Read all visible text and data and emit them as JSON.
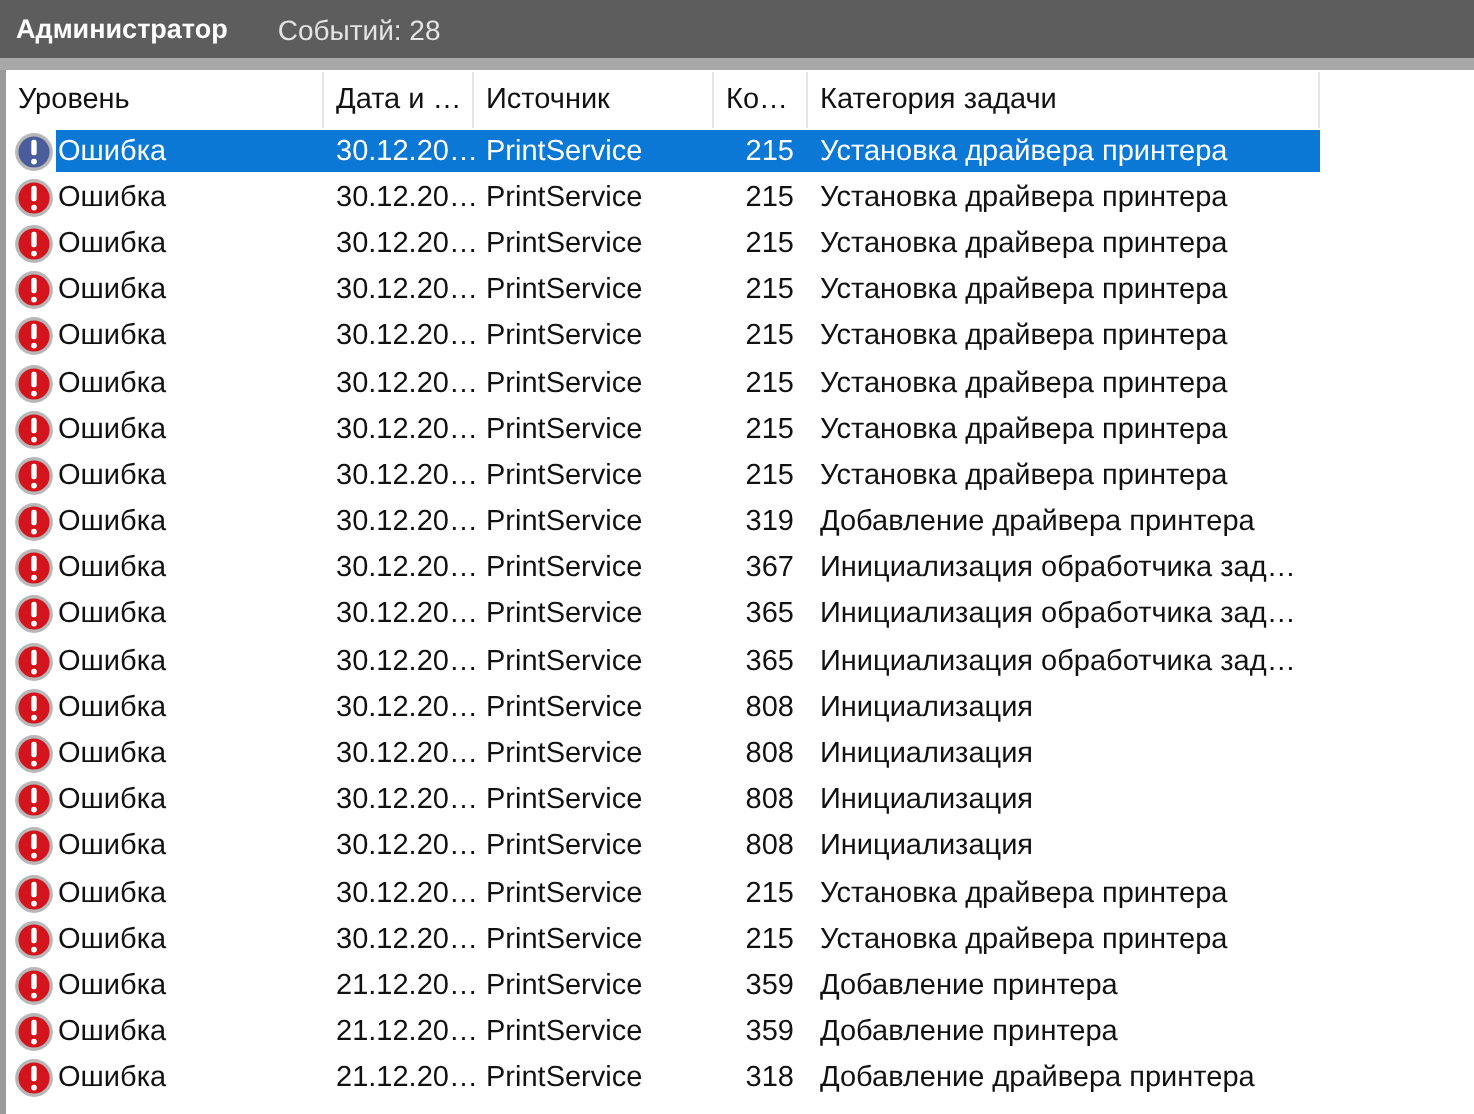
{
  "header": {
    "title": "Администратор",
    "count": "Событий: 28"
  },
  "table": {
    "columns": [
      "Уровень",
      "Дата и …",
      "Источник",
      "Ко…",
      "Категория задачи"
    ],
    "rows": [
      {
        "selected": true,
        "level": "Ошибка",
        "date": "30.12.20…",
        "source": "PrintService",
        "code": "215",
        "category": "Установка драйвера принтера"
      },
      {
        "selected": false,
        "level": "Ошибка",
        "date": "30.12.20…",
        "source": "PrintService",
        "code": "215",
        "category": "Установка драйвера принтера"
      },
      {
        "selected": false,
        "level": "Ошибка",
        "date": "30.12.20…",
        "source": "PrintService",
        "code": "215",
        "category": "Установка драйвера принтера"
      },
      {
        "selected": false,
        "level": "Ошибка",
        "date": "30.12.20…",
        "source": "PrintService",
        "code": "215",
        "category": "Установка драйвера принтера"
      },
      {
        "selected": false,
        "level": "Ошибка",
        "date": "30.12.20…",
        "source": "PrintService",
        "code": "215",
        "category": "Установка драйвера принтера"
      },
      {
        "selected": false,
        "level": "Ошибка",
        "date": "30.12.20…",
        "source": "PrintService",
        "code": "215",
        "category": "Установка драйвера принтера"
      },
      {
        "selected": false,
        "level": "Ошибка",
        "date": "30.12.20…",
        "source": "PrintService",
        "code": "215",
        "category": "Установка драйвера принтера"
      },
      {
        "selected": false,
        "level": "Ошибка",
        "date": "30.12.20…",
        "source": "PrintService",
        "code": "215",
        "category": "Установка драйвера принтера"
      },
      {
        "selected": false,
        "level": "Ошибка",
        "date": "30.12.20…",
        "source": "PrintService",
        "code": "319",
        "category": "Добавление драйвера принтера"
      },
      {
        "selected": false,
        "level": "Ошибка",
        "date": "30.12.20…",
        "source": "PrintService",
        "code": "367",
        "category": "Инициализация обработчика зад…"
      },
      {
        "selected": false,
        "level": "Ошибка",
        "date": "30.12.20…",
        "source": "PrintService",
        "code": "365",
        "category": "Инициализация обработчика зад…"
      },
      {
        "selected": false,
        "level": "Ошибка",
        "date": "30.12.20…",
        "source": "PrintService",
        "code": "365",
        "category": "Инициализация обработчика зад…"
      },
      {
        "selected": false,
        "level": "Ошибка",
        "date": "30.12.20…",
        "source": "PrintService",
        "code": "808",
        "category": "Инициализация"
      },
      {
        "selected": false,
        "level": "Ошибка",
        "date": "30.12.20…",
        "source": "PrintService",
        "code": "808",
        "category": "Инициализация"
      },
      {
        "selected": false,
        "level": "Ошибка",
        "date": "30.12.20…",
        "source": "PrintService",
        "code": "808",
        "category": "Инициализация"
      },
      {
        "selected": false,
        "level": "Ошибка",
        "date": "30.12.20…",
        "source": "PrintService",
        "code": "808",
        "category": "Инициализация"
      },
      {
        "selected": false,
        "level": "Ошибка",
        "date": "30.12.20…",
        "source": "PrintService",
        "code": "215",
        "category": "Установка драйвера принтера"
      },
      {
        "selected": false,
        "level": "Ошибка",
        "date": "30.12.20…",
        "source": "PrintService",
        "code": "215",
        "category": "Установка драйвера принтера"
      },
      {
        "selected": false,
        "level": "Ошибка",
        "date": "21.12.20…",
        "source": "PrintService",
        "code": "359",
        "category": "Добавление принтера"
      },
      {
        "selected": false,
        "level": "Ошибка",
        "date": "21.12.20…",
        "source": "PrintService",
        "code": "359",
        "category": "Добавление принтера"
      },
      {
        "selected": false,
        "level": "Ошибка",
        "date": "21.12.20…",
        "source": "PrintService",
        "code": "318",
        "category": "Добавление драйвера принтера"
      }
    ]
  }
}
